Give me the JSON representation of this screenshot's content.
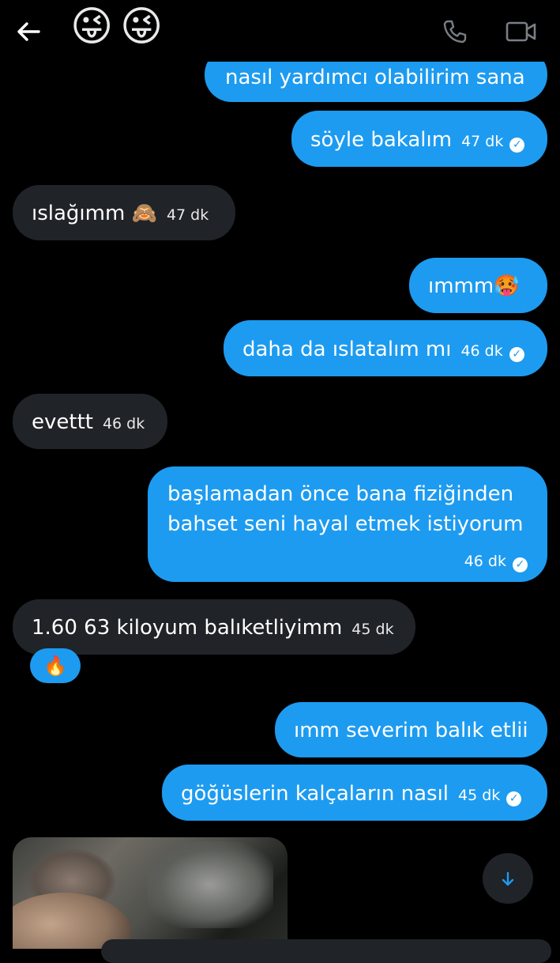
{
  "header": {
    "back_icon": "arrow-left-icon",
    "title_emoji": [
      "😜",
      "😜"
    ],
    "call_icon": "phone-icon",
    "video_icon": "video-camera-icon"
  },
  "messages": [
    {
      "dir": "out",
      "text": "nasıl yardımcı olabilirim sana",
      "time": "",
      "read": false
    },
    {
      "dir": "out",
      "text": "söyle bakalım",
      "time": "47 dk",
      "read": true
    },
    {
      "dir": "in",
      "text": "ıslağımm 🙈",
      "time": "47 dk"
    },
    {
      "dir": "out",
      "text": "ımmm🥵",
      "time": "",
      "read": false
    },
    {
      "dir": "out",
      "text": "daha da ıslatalım mı",
      "time": "46 dk",
      "read": true
    },
    {
      "dir": "in",
      "text": "evettt",
      "time": "46 dk"
    },
    {
      "dir": "out",
      "text_line1": "başlamadan önce bana fiziğinden",
      "text_line2": "bahset seni hayal etmek istiyorum",
      "time": "46 dk",
      "read": true
    },
    {
      "dir": "in",
      "text": "1.60 63 kiloyum balıketliyimm",
      "time": "45 dk",
      "reaction": "🔥"
    },
    {
      "dir": "out",
      "text": "ımm severim balık etlii",
      "time": "",
      "read": false
    },
    {
      "dir": "out",
      "text": "göğüslerin kalçaların nasıl",
      "time": "45 dk",
      "read": true
    }
  ],
  "scroll_down_icon": "arrow-down-icon",
  "colors": {
    "accent": "#1d9bf0",
    "incoming": "#202327",
    "background": "#000000"
  }
}
